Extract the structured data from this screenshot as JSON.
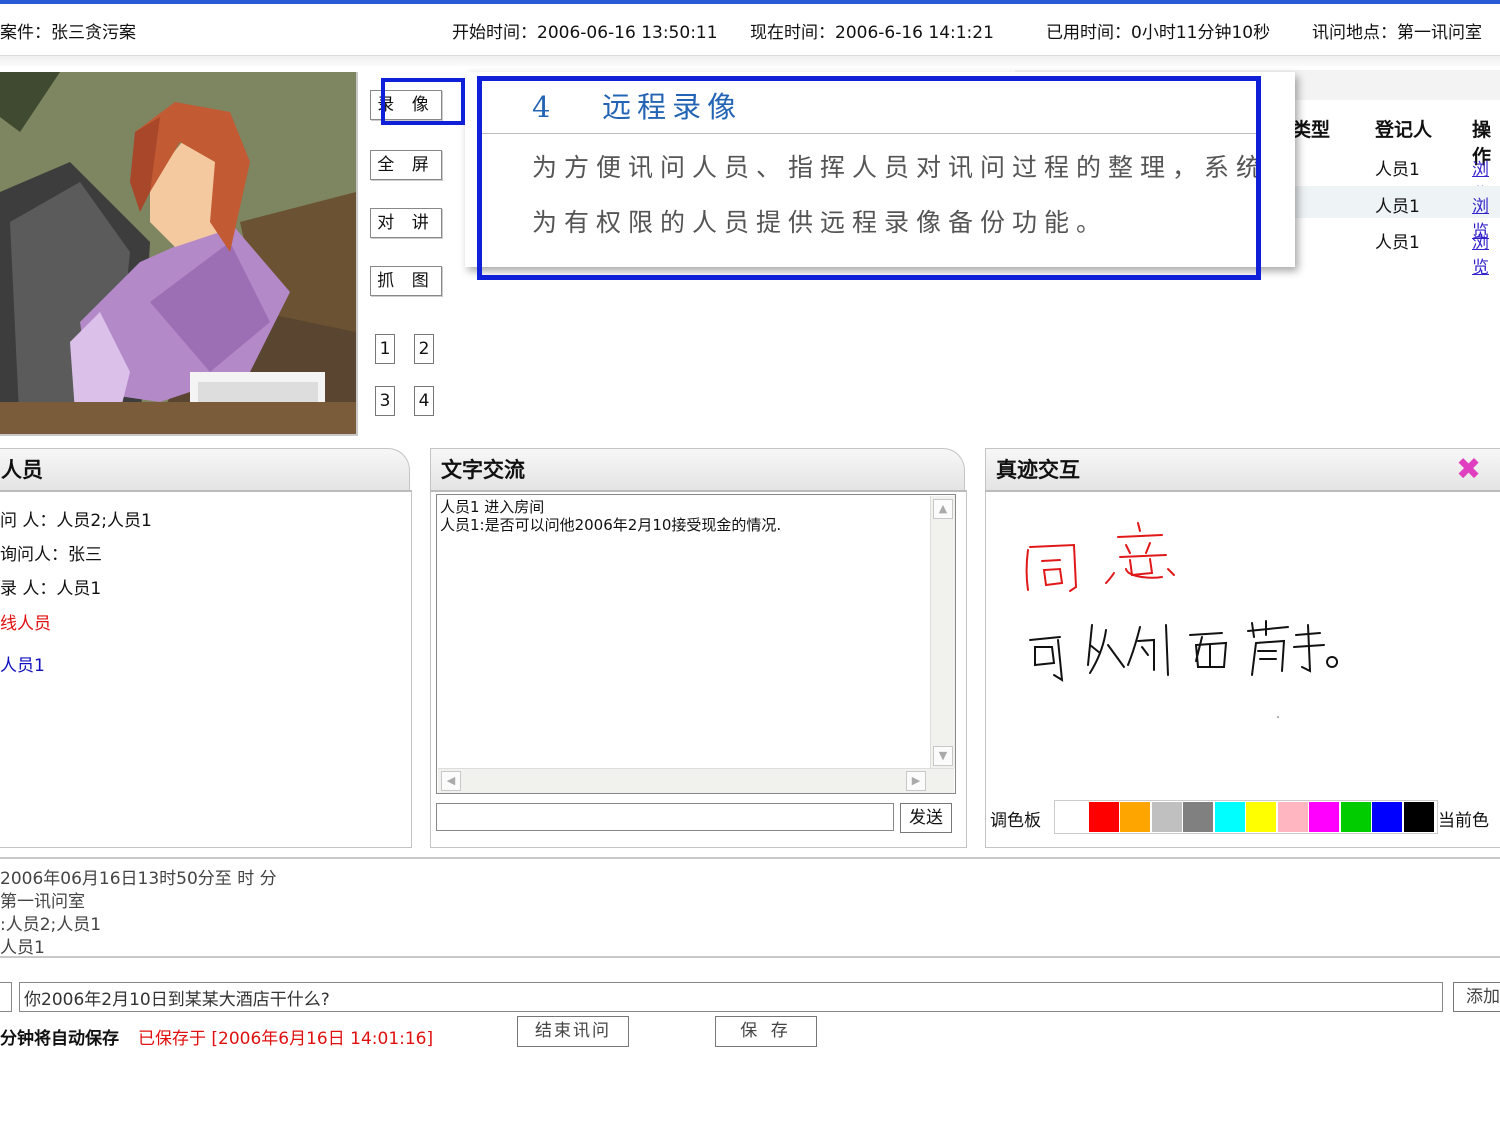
{
  "header": {
    "case": "案件：张三贪污案",
    "start_time": "开始时间：2006-06-16 13:50:11",
    "now_time": "现在时间：2006-6-16 14:1:21",
    "elapsed": "已用时间：0小时11分钟10秒",
    "location": "讯问地点：第一讯问室"
  },
  "controls": {
    "record": "录 像",
    "fullscreen": "全 屏",
    "intercom": "对 讲",
    "capture": "抓 图",
    "ch1": "1",
    "ch2": "2",
    "ch3": "3",
    "ch4": "4"
  },
  "callout": {
    "number": "4",
    "title": "远程录像",
    "line1": "为方便讯问人员、指挥人员对讯问过程的整理，系统",
    "line2": "为有权限的人员提供远程录像备份功能。"
  },
  "record_table": {
    "col_type": "类型",
    "col_registrant": "登记人",
    "col_action": "操作",
    "rows": [
      {
        "registrant": "人员1",
        "action": "浏览"
      },
      {
        "registrant": "人员1",
        "action": "浏览"
      },
      {
        "registrant": "人员1",
        "action": "浏览"
      }
    ]
  },
  "participants": {
    "title": "人员",
    "interrogator": "问 人：人员2;人员1",
    "interviewee": "询问人：张三",
    "recorder": "录 人：人员1",
    "online_label": "线人员",
    "online_user": "人员1"
  },
  "chat": {
    "title": "文字交流",
    "messages": [
      "人员1 进入房间",
      "人员1:是否可以问他2006年2月10接受现金的情况."
    ],
    "send": "发送"
  },
  "handwriting": {
    "title": "真迹交互",
    "palette_label": "调色板",
    "current_label": "当前色",
    "colors": [
      "#ffffff",
      "#ff0000",
      "#ffa500",
      "#c0c0c0",
      "#808080",
      "#00ffff",
      "#ffff00",
      "#ffb6c1",
      "#ff00ff",
      "#00cc00",
      "#0000ff",
      "#000000"
    ],
    "ink1": "同意",
    "ink2": "可从侧面着手。"
  },
  "summary": {
    "line1": "2006年06月16日13时50分至 时 分",
    "line2": "第一讯问室",
    "line3": ":人员2;人员1",
    "line4": "人员1"
  },
  "question": {
    "input_value": "你2006年2月10日到某某大酒店干什么?",
    "add": "添加"
  },
  "footer": {
    "autosave": "分钟将自动保存",
    "saved": "已保存于 [2006年6月16日 14:01:16]",
    "end": "结束讯问",
    "save": "保 存"
  }
}
